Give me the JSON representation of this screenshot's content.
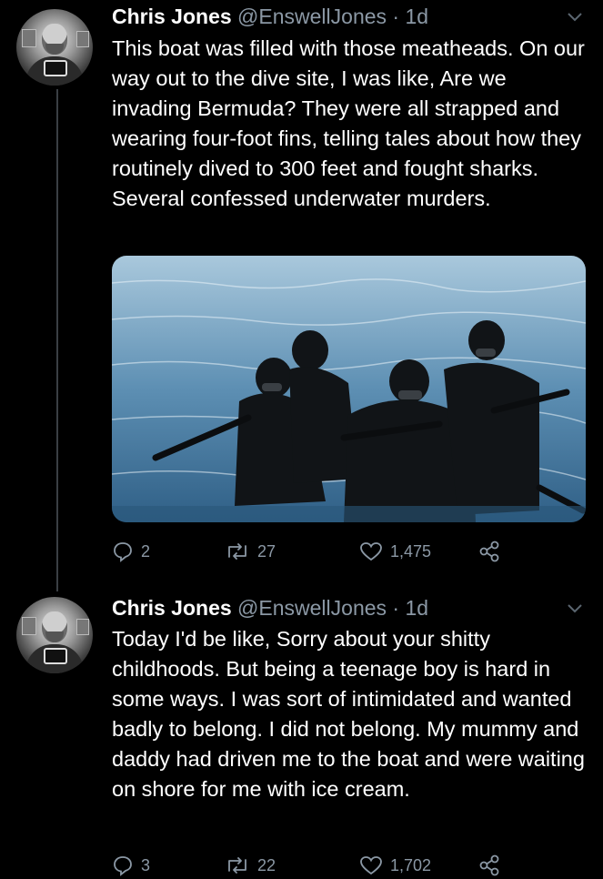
{
  "tweets": [
    {
      "author_name": "Chris Jones",
      "handle": "@EnswellJones",
      "separator": "·",
      "age": "1d",
      "text": "This boat was filled with those meatheads. On our way out to the dive site, I was like, Are we invading Bermuda? They were all strapped and wearing four-foot fins, telling tales about how they routinely dived to 300 feet and fought sharks. Several confessed underwater murders.",
      "actions": {
        "replies": "2",
        "retweets": "27",
        "likes": "1,475"
      }
    },
    {
      "author_name": "Chris Jones",
      "handle": "@EnswellJones",
      "separator": "·",
      "age": "1d",
      "text": "Today I'd be like, Sorry about your shitty childhoods. But being a teenage boy is hard in some ways. I was sort of intimidated and wanted badly to belong. I did not belong. My mummy and daddy had driven me to the boat and were waiting on shore for me with ice cream.",
      "actions": {
        "replies": "3",
        "retweets": "22",
        "likes": "1,702"
      }
    }
  ],
  "icons": [
    "chevron-down-icon",
    "reply-icon",
    "retweet-icon",
    "like-icon",
    "share-icon"
  ],
  "colors": {
    "background": "#000000",
    "text": "#ffffff",
    "secondary": "#8b98a5",
    "thread_line": "#3a3f44"
  }
}
